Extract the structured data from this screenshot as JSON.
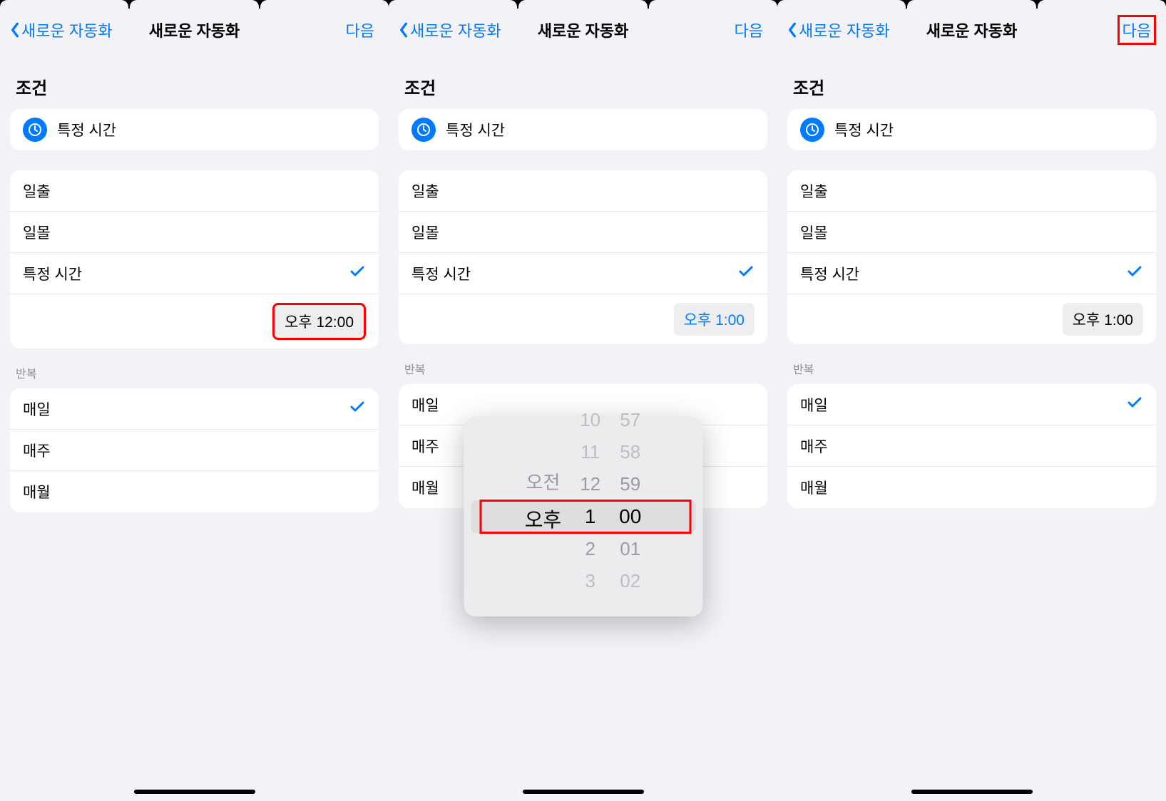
{
  "nav": {
    "back_label": "새로운 자동화",
    "title": "새로운 자동화",
    "next_label": "다음"
  },
  "section": {
    "condition": "조건",
    "repeat": "반복"
  },
  "cond": {
    "specific_time": "특정 시간",
    "sunrise": "일출",
    "sunset": "일몰"
  },
  "repeat": {
    "daily": "매일",
    "weekly": "매주",
    "monthly": "매월"
  },
  "times": {
    "s1": "오후 12:00",
    "s2": "오후 1:00",
    "s3": "오후 1:00"
  },
  "picker": {
    "ampm_prev": "오전",
    "ampm_sel": "오후",
    "h_m2": "10",
    "h_m1": "11",
    "h_0": "12",
    "h_sel": "1",
    "h_p1": "2",
    "h_p2": "3",
    "m_m2": "57",
    "m_m1": "58",
    "m_0": "59",
    "m_sel": "00",
    "m_p1": "01",
    "m_p2": "02"
  }
}
